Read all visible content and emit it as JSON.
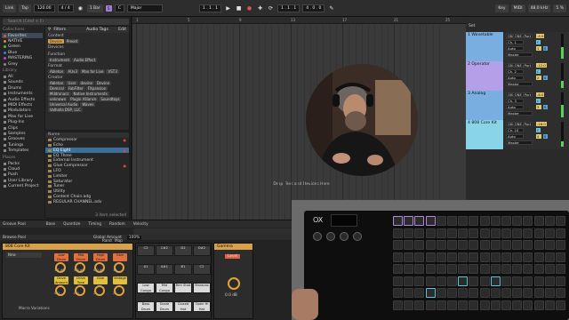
{
  "topbar": {
    "link": "Link",
    "tap": "Tap",
    "tempo": "120.00",
    "time_sig": "4 / 4",
    "metro_rate": "1 Bar",
    "key_root": "C",
    "scale": "Major",
    "position": "1 . 1 . 1",
    "loop_start": "1 . 1 . 1",
    "loop_len": "4 . 0 . 0",
    "key_label": "Key",
    "midi_label": "MIDI",
    "sample_rate": "48.0 kHz",
    "cpu": "5 %"
  },
  "browser": {
    "search_placeholder": "Search (Cmd + F)",
    "collections_header": "Collections",
    "collections": [
      {
        "label": "Favorites",
        "color": "#e05a3a",
        "selected": true
      },
      {
        "label": "NATIVE",
        "color": "#e08a3a",
        "selected": false
      },
      {
        "label": "Green",
        "color": "#4ac04a",
        "selected": false
      },
      {
        "label": "Blue",
        "color": "#3a7ae0",
        "selected": false
      },
      {
        "label": "MASTERING",
        "color": "#c04ac0",
        "selected": false
      },
      {
        "label": "Grey",
        "color": "#8a8a8a",
        "selected": false
      }
    ],
    "library_header": "Library",
    "library": [
      "All",
      "Sounds",
      "Drums",
      "Instruments",
      "Audio Effects",
      "MIDI Effects",
      "Modulators",
      "Max for Live",
      "Plug-Ins",
      "Clips",
      "Samples",
      "Grooves",
      "Tunings",
      "Templates"
    ],
    "places_header": "Places",
    "places": [
      "Packs",
      "Cloud",
      "Push",
      "User Library",
      "Current Project"
    ],
    "filters_title": "Filters",
    "audio_tags": "Audio Tags",
    "edit": "Edit",
    "filter_sections": [
      {
        "title": "Content",
        "chips": [
          "Device",
          "Preset"
        ]
      },
      {
        "title": "Devices",
        "chips": []
      },
      {
        "title": "Function",
        "chips": [
          "Instrument",
          "Audio Effect"
        ]
      },
      {
        "title": "Format",
        "chips": [
          "Ableton",
          "AUv3",
          "Max for Live",
          "VST3"
        ]
      },
      {
        "title": "Creator",
        "chips": [
          "Ableton",
          "User",
          "devine",
          "Devine",
          "Demiral",
          "FabFilter",
          "FXpansion",
          "Mildronacs",
          "Native Instruments",
          "unknown",
          "Plugin Alliance",
          "Soundtoys",
          "Universal Audio",
          "Waves",
          "Valhalla DSP, LLC"
        ]
      }
    ],
    "name_header": "Name",
    "files": [
      {
        "label": "Compressor",
        "selected": false,
        "fav": true
      },
      {
        "label": "Echo",
        "selected": false,
        "fav": false
      },
      {
        "label": "EQ Eight",
        "selected": true,
        "fav": true
      },
      {
        "label": "EQ Three",
        "selected": false,
        "fav": false
      },
      {
        "label": "External Instrument",
        "selected": false,
        "fav": false
      },
      {
        "label": "Glue Compressor",
        "selected": false,
        "fav": true
      },
      {
        "label": "LFO",
        "selected": false,
        "fav": false
      },
      {
        "label": "Limiter",
        "selected": false,
        "fav": false
      },
      {
        "label": "Saturator",
        "selected": false,
        "fav": false
      },
      {
        "label": "Tuner",
        "selected": false,
        "fav": false
      },
      {
        "label": "Utility",
        "selected": false,
        "fav": false
      },
      {
        "label": "Content Chain.adg",
        "selected": false,
        "fav": false
      },
      {
        "label": "REGULAR CHANNEL.adv",
        "selected": false,
        "fav": false
      }
    ],
    "items_count": "3 item selected"
  },
  "arrangement": {
    "drop_text": "Drop Files and Devices Here",
    "ruler": [
      "1",
      "5",
      "9",
      "13",
      "17",
      "21",
      "25"
    ]
  },
  "tracks": {
    "set_label": "Set",
    "items": [
      {
        "name": "1 Wavetable",
        "color": "#78aee0",
        "input": "OXI ONE (Port",
        "ch": "Ch. 1",
        "mon": "Auto",
        "out": "Master",
        "vol": "-4.0",
        "pan": "C",
        "level": 0.45
      },
      {
        "name": "2 Operator",
        "color": "#b4a0e8",
        "input": "OXI ONE (Port",
        "ch": "Ch. 2",
        "mon": "Auto",
        "out": "Master",
        "vol": "-12.0",
        "pan": "C",
        "level": 0.3
      },
      {
        "name": "3 Analog",
        "color": "#78aee0",
        "input": "OXI ONE (Port",
        "ch": "Ch. 3",
        "mon": "Auto",
        "out": "Master",
        "vol": "-6.0",
        "pan": "C",
        "level": 0.5
      },
      {
        "name": "4 808 Core Kit",
        "color": "#8ad4e8",
        "input": "OXI ONE (Port",
        "ch": "Ch. 10",
        "mon": "Auto",
        "out": "Master",
        "vol": "-18.0",
        "pan": "C",
        "level": 0.2
      }
    ]
  },
  "bottom": {
    "groove_pool": "Groove Pool",
    "columns": [
      "Base",
      "Quantize",
      "Timing",
      "Random",
      "Velocity"
    ],
    "groove_amount_label": "Global Amount",
    "groove_amount": "100%",
    "browse_label": "Browse Pool",
    "device_title": "808 Core Kit",
    "preset": "New",
    "rand_label": "Rand",
    "map_label": "Map",
    "macro_labels": [
      "Low Drum",
      "Mid Drum",
      "High Drum",
      "Gain",
      "Drive Amount",
      "Drive Tone",
      "Glue",
      "Vintage"
    ],
    "macro_values": [
      "1.7 dB",
      "5.3 dB",
      "0.0 dB",
      "12",
      "0.0",
      "0.0",
      "2",
      "2"
    ],
    "macro_variations": "Macro Variations",
    "drum_pads": [
      {
        "label": "C2",
        "white": false
      },
      {
        "label": "C#2",
        "white": false
      },
      {
        "label": "D2",
        "white": false
      },
      {
        "label": "D#2",
        "white": false
      },
      {
        "label": "A1",
        "white": false
      },
      {
        "label": "A#1",
        "white": false
      },
      {
        "label": "B1",
        "white": false
      },
      {
        "label": "C2",
        "white": false
      },
      {
        "label": "Low Conga",
        "white": true
      },
      {
        "label": "Mid Conga",
        "white": true
      },
      {
        "label": "Rim Shot",
        "white": true
      },
      {
        "label": "Maracas",
        "white": true
      },
      {
        "label": "Bass Drum",
        "white": true
      },
      {
        "label": "Snare Drum",
        "white": true
      },
      {
        "label": "Closed Hat",
        "white": true
      },
      {
        "label": "Open Hi Hat",
        "white": true
      }
    ],
    "comp_title": "Gamma",
    "comp_label": "Level",
    "comp_value": "0.0 dB"
  }
}
